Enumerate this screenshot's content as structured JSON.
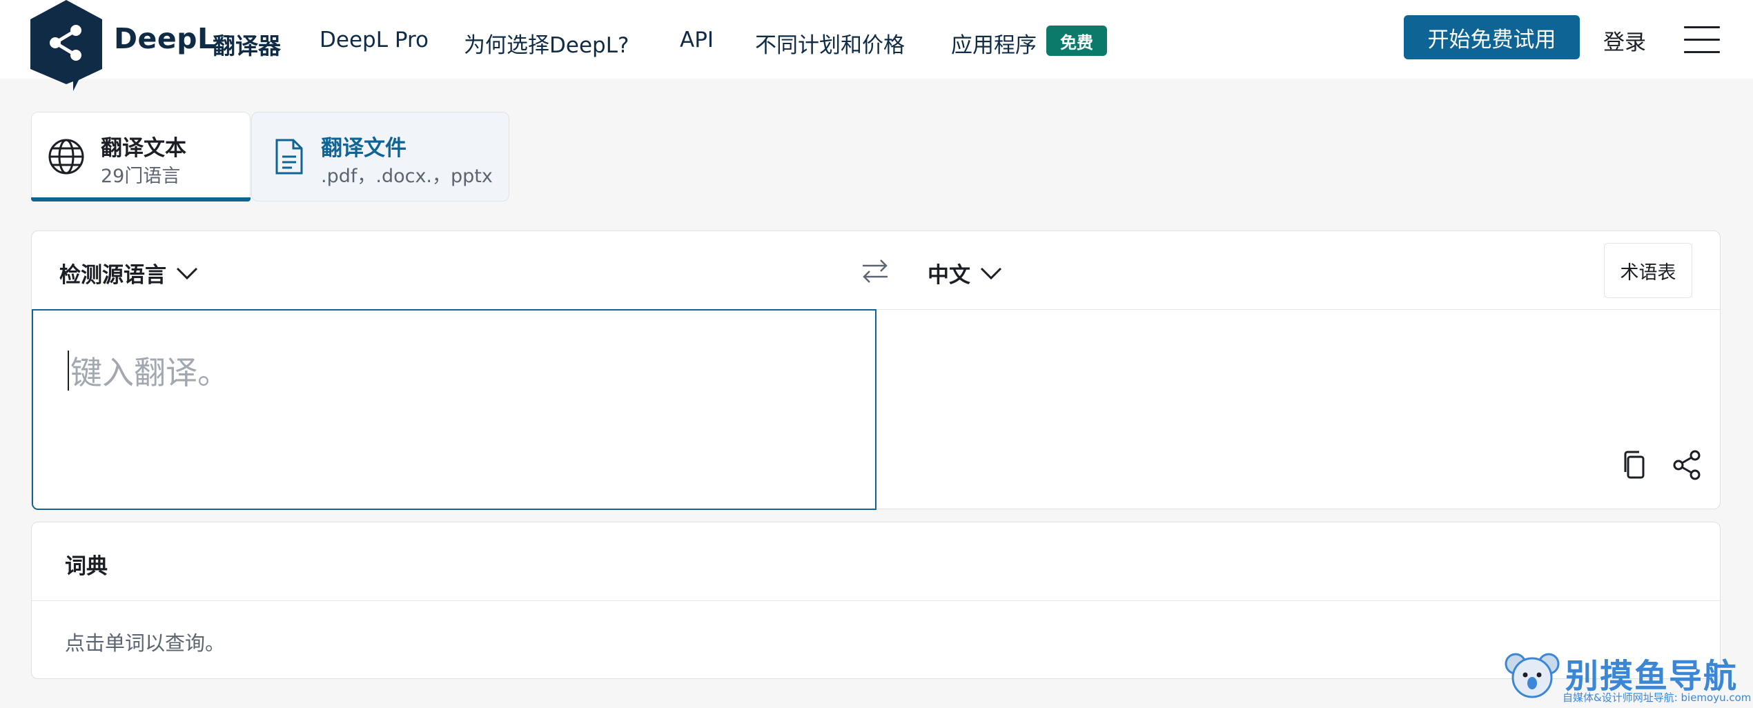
{
  "header": {
    "brand": "DeepL",
    "brand_sub": "翻译器",
    "nav": [
      "DeepL Pro",
      "为何选择DeepL?",
      "API",
      "不同计划和价格",
      "应用程序"
    ],
    "badge": "免费",
    "cta": "开始免费试用",
    "login": "登录"
  },
  "tabs": [
    {
      "title": "翻译文本",
      "subtitle": "29门语言",
      "icon": "globe-icon",
      "active": true
    },
    {
      "title": "翻译文件",
      "subtitle": ".pdf，.docx.，pptx",
      "icon": "document-icon",
      "active": false
    }
  ],
  "translator": {
    "source_lang": "检测源语言",
    "target_lang": "中文",
    "glossary": "术语表",
    "placeholder": "键入翻译。",
    "actions": [
      "copy-icon",
      "share-icon"
    ]
  },
  "dictionary": {
    "title": "词典",
    "hint": "点击单词以查询。"
  },
  "watermark": {
    "title": "别摸鱼导航",
    "subtitle": "自媒体&设计师网址导航: biemoyu.com"
  },
  "colors": {
    "brand_navy": "#0f2b46",
    "primary_blue": "#0f6496",
    "badge_green": "#0b7a6a",
    "page_bg": "#f6f6f7",
    "watermark_blue": "#3b87d6"
  }
}
